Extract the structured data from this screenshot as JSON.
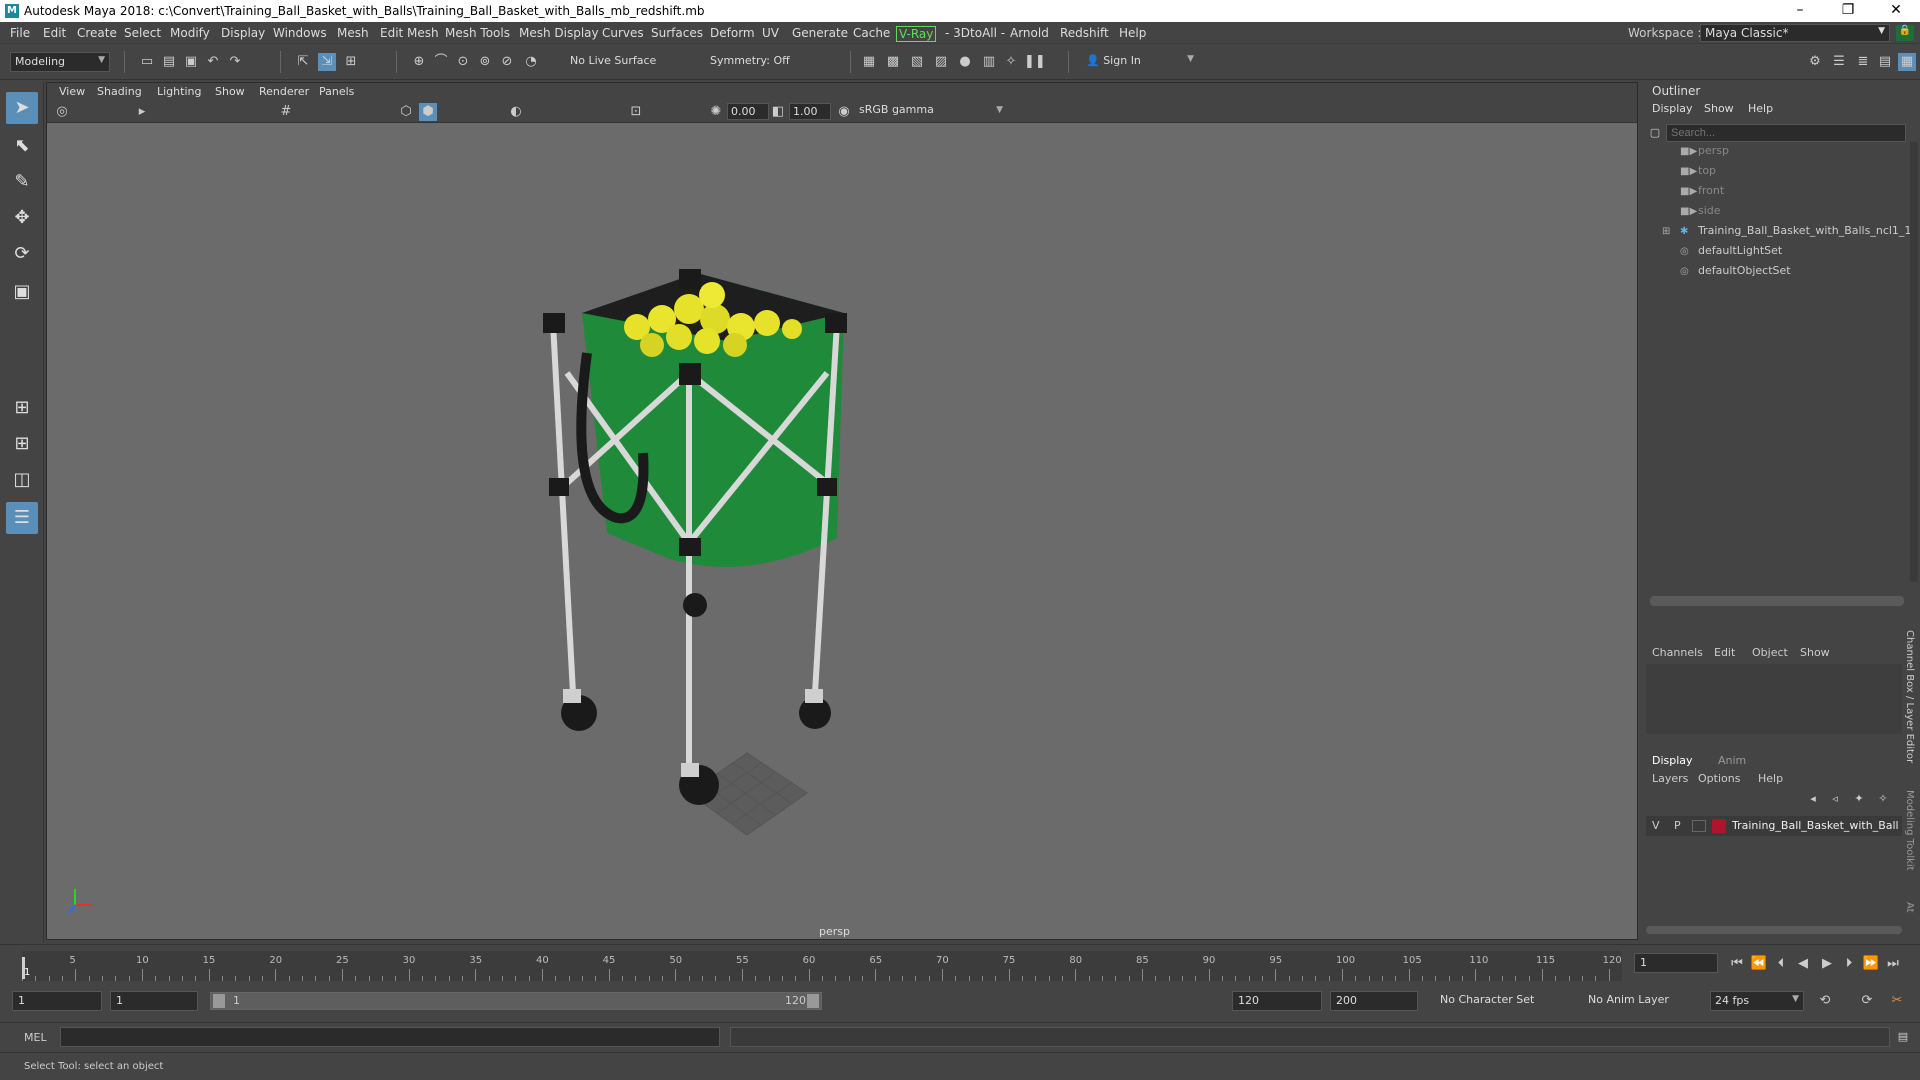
{
  "window": {
    "title": "Autodesk Maya 2018: c:\\Convert\\Training_Ball_Basket_with_Balls\\Training_Ball_Basket_with_Balls_mb_redshift.mb",
    "minimize": "–",
    "maximize": "❐",
    "close": "✕"
  },
  "menu": [
    "File",
    "Edit",
    "Create",
    "Select",
    "Modify",
    "Display",
    "Windows",
    "Mesh",
    "Edit Mesh",
    "Mesh Tools",
    "Mesh Display",
    "Curves",
    "Surfaces",
    "Deform",
    "UV",
    "Generate",
    "Cache",
    "V-Ray",
    "- 3DtoAll -",
    "Arnold",
    "Redshift",
    "Help"
  ],
  "workspace": {
    "label": "Workspace :",
    "value": "Maya Classic*"
  },
  "toolbar": {
    "mode": "Modeling",
    "live_surface": "No Live Surface",
    "symmetry": "Symmetry: Off",
    "sign_in": "Sign In"
  },
  "viewport": {
    "menu": [
      "View",
      "Shading",
      "Lighting",
      "Show",
      "Renderer",
      "Panels"
    ],
    "exposure": "0.00",
    "gamma": "1.00",
    "colorspace": "sRGB gamma",
    "camera": "persp"
  },
  "outliner": {
    "title": "Outliner",
    "menu": [
      "Display",
      "Show",
      "Help"
    ],
    "search_placeholder": "Search...",
    "items": [
      {
        "label": "persp",
        "dim": true
      },
      {
        "label": "top",
        "dim": true
      },
      {
        "label": "front",
        "dim": true
      },
      {
        "label": "side",
        "dim": true
      },
      {
        "label": "Training_Ball_Basket_with_Balls_ncl1_1",
        "dim": false
      },
      {
        "label": "defaultLightSet",
        "dim": false
      },
      {
        "label": "defaultObjectSet",
        "dim": false
      }
    ]
  },
  "channels": {
    "menu": [
      "Channels",
      "Edit",
      "Object",
      "Show"
    ]
  },
  "layers": {
    "tabs": [
      "Display",
      "Anim"
    ],
    "menu": [
      "Layers",
      "Options",
      "Help"
    ],
    "row": {
      "v": "V",
      "p": "P",
      "name": "Training_Ball_Basket_with_Ball"
    }
  },
  "side_tabs": {
    "channel_box": "Channel Box / Layer Editor",
    "modeling_toolkit": "Modeling Toolkit",
    "attr": "At"
  },
  "timeline": {
    "ticks": [
      "5",
      "10",
      "15",
      "20",
      "25",
      "30",
      "35",
      "40",
      "45",
      "50",
      "55",
      "60",
      "65",
      "70",
      "75",
      "80",
      "85",
      "90",
      "95",
      "100",
      "105",
      "110",
      "115",
      "120"
    ],
    "current_frame": "1",
    "start_marker": "1"
  },
  "range": {
    "start": "1",
    "playback_start": "1",
    "slider_start": "1",
    "slider_end": "120",
    "playback_end": "120",
    "end": "200",
    "char_set": "No Character Set",
    "anim_layer": "No Anim Layer",
    "fps": "24 fps"
  },
  "mel": {
    "label": "MEL"
  },
  "status": {
    "text": "Select Tool: select an object"
  },
  "colors": {
    "accent": "#5b8fb8",
    "vray": "#5fdc5f",
    "layer_color": "#b0142c"
  }
}
